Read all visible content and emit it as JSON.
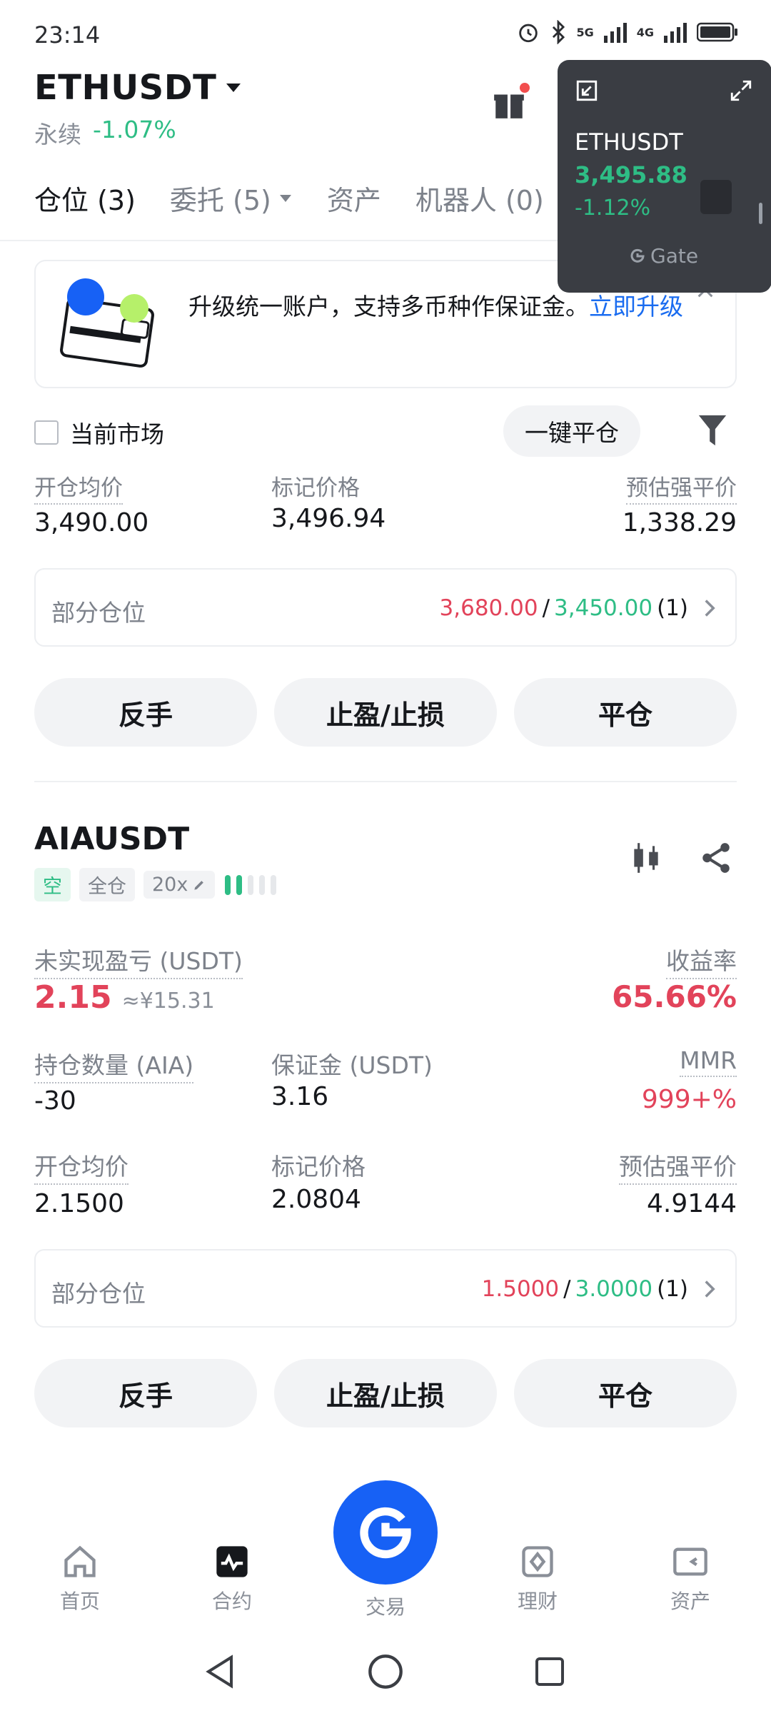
{
  "status": {
    "time": "23:14",
    "net1": "5G",
    "net2": "4G"
  },
  "header": {
    "symbol": "ETHUSDT",
    "type": "永续",
    "change": "-1.07%"
  },
  "tabs": [
    {
      "label": "仓位 (3)"
    },
    {
      "label": "委托 (5)"
    },
    {
      "label": "资产"
    },
    {
      "label": "机器人 (0)"
    }
  ],
  "floating_widget": {
    "symbol": "ETHUSDT",
    "price": "3,495.88",
    "change": "-1.12%",
    "brand": "Gate"
  },
  "banner": {
    "text": "升级统一账户，支持多币种作保证金。",
    "link": "立即升级"
  },
  "filter_bar": {
    "current_market": "当前市场",
    "close_all": "一键平仓"
  },
  "eth_position": {
    "entry_price_label": "开仓均价",
    "entry_price": "3,490.00",
    "mark_price_label": "标记价格",
    "mark_price": "3,496.94",
    "liq_price_label": "预估强平价",
    "liq_price": "1,338.29",
    "partial_label": "部分仓位",
    "partial_tp": "3,680.00",
    "partial_sl": "3,450.00",
    "partial_count": "(1)",
    "btn_reverse": "反手",
    "btn_tpsl": "止盈/止损",
    "btn_close": "平仓"
  },
  "aia_position": {
    "symbol": "AIAUSDT",
    "side": "空",
    "margin_mode": "全仓",
    "leverage": "20x",
    "pnl_label": "未实现盈亏 (USDT)",
    "pnl": "2.15",
    "pnl_cny": "≈¥15.31",
    "roe_label": "收益率",
    "roe": "65.66%",
    "size_label": "持仓数量 (AIA)",
    "size": "-30",
    "margin_label": "保证金 (USDT)",
    "margin": "3.16",
    "mmr_label": "MMR",
    "mmr": "999+%",
    "entry_price_label": "开仓均价",
    "entry_price": "2.1500",
    "mark_price_label": "标记价格",
    "mark_price": "2.0804",
    "liq_price_label": "预估强平价",
    "liq_price": "4.9144",
    "partial_label": "部分仓位",
    "partial_tp": "1.5000",
    "partial_sl": "3.0000",
    "partial_count": "(1)",
    "btn_reverse": "反手",
    "btn_tpsl": "止盈/止损",
    "btn_close": "平仓"
  },
  "bottom_nav": {
    "home": "首页",
    "futures": "合约",
    "trade": "交易",
    "earn": "理财",
    "assets": "资产"
  },
  "colors": {
    "green": "#2ebd85",
    "red": "#e2435a",
    "orange": "#f0923a",
    "brand_blue": "#1761f5"
  }
}
